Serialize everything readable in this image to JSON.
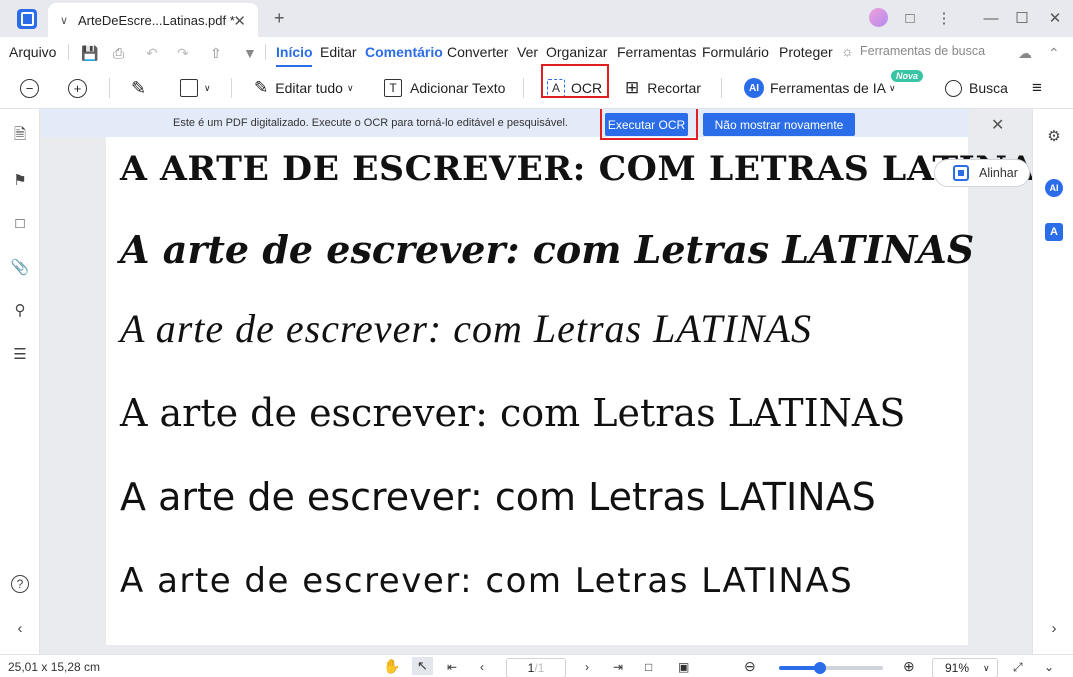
{
  "tab": {
    "title": "ArteDeEscre...Latinas.pdf *"
  },
  "menu": {
    "file": "Arquivo",
    "items": [
      "Início",
      "Editar",
      "Comentário",
      "Converter",
      "Ver",
      "Organizar",
      "Ferramentas",
      "Formulário",
      "Proteger"
    ],
    "search_tools": "Ferramentas de busca"
  },
  "toolbar": {
    "edit_all": "Editar tudo",
    "add_text": "Adicionar Texto",
    "ocr": "OCR",
    "crop": "Recortar",
    "ai_tools": "Ferramentas de IA",
    "ai_icon": "AI",
    "nova": "Nova",
    "search": "Busca"
  },
  "notice": {
    "text": "Este é um PDF digitalizado. Execute o OCR para torná-lo editável e pesquisável.",
    "run_ocr": "Executar OCR",
    "dont_show": "Não mostrar novamente"
  },
  "align": {
    "label": "Alinhar"
  },
  "document": {
    "lines": [
      "A ARTE DE ESCREVER: COM LETRAS LATINAS",
      "A arte de escrever: com Letras LATINAS",
      "A arte de escrever: com Letras LATINAS",
      "A arte de escrever: com Letras LATINAS",
      "A arte de escrever: com Letras LATINAS",
      "A arte de escrever: com Letras LATINAS"
    ]
  },
  "rightrail": {
    "ai_icon": "AI",
    "translate_icon": "A"
  },
  "status": {
    "dimensions": "25,01 x 15,28 cm",
    "page_current": "1",
    "page_total": "/1",
    "zoom": "91%",
    "zoom_level": 0.39
  },
  "colors": {
    "accent": "#2b6de8",
    "highlight": "#e02020"
  }
}
